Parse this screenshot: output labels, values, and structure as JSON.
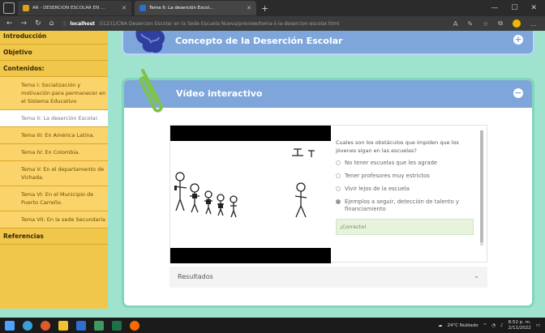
{
  "browser": {
    "tab1_title": "AR - DESERCION ESCOLAR EN ...",
    "tab2_title": "Tema II: La deserción Escol...",
    "url_host": "localhost",
    "url_rest": ":51231/CNA Desercion Escolar en la Sede Escuela Nueva/preview/tema-ii-la-desercion-escolar.html"
  },
  "sidebar": {
    "items": [
      {
        "label": "Introducción",
        "kind": "bold"
      },
      {
        "label": "Objetivo",
        "kind": "bold"
      },
      {
        "label": "Contenidos:",
        "kind": "bold"
      },
      {
        "label": "Tema I: Socialización y motivación para permanecer en el Sistema Educativo",
        "kind": "sub"
      },
      {
        "label": "Tema II: La deserción Escolar.",
        "kind": "current"
      },
      {
        "label": "Tema III: En América Latina.",
        "kind": "sub"
      },
      {
        "label": "Tema IV: En Colombia.",
        "kind": "sub"
      },
      {
        "label": "Tema V: En el departamento de Vichada.",
        "kind": "sub"
      },
      {
        "label": "Tema VI: En el Municipio de Puerto Carreño.",
        "kind": "sub"
      },
      {
        "label": "Tema VII: En la sede Secundaria",
        "kind": "sub"
      },
      {
        "label": "Referencias",
        "kind": "bold"
      }
    ]
  },
  "panel_concept": {
    "title": "Concepto de la Deserción Escolar",
    "toggle": "+"
  },
  "panel_video": {
    "title": "Vídeo interactivo",
    "toggle": "−"
  },
  "quiz": {
    "question": "Cuales son los obstáculos que impiden que los jóvenes sigan en las escuelas?",
    "options": [
      "No tener escuelas que les agrade",
      "Tener profesores muy estrictos",
      "Vivir lejos de la escuela",
      "Ejemplos a seguir, detección de talento y financiamiento"
    ],
    "selected_index": 3,
    "feedback": "¡Correcto!"
  },
  "results": {
    "label": "Resultados",
    "chevron": "⌄"
  },
  "taskbar": {
    "weather": "24°C Nublado",
    "time": "8:52 p. m.",
    "date": "2/11/2022"
  }
}
